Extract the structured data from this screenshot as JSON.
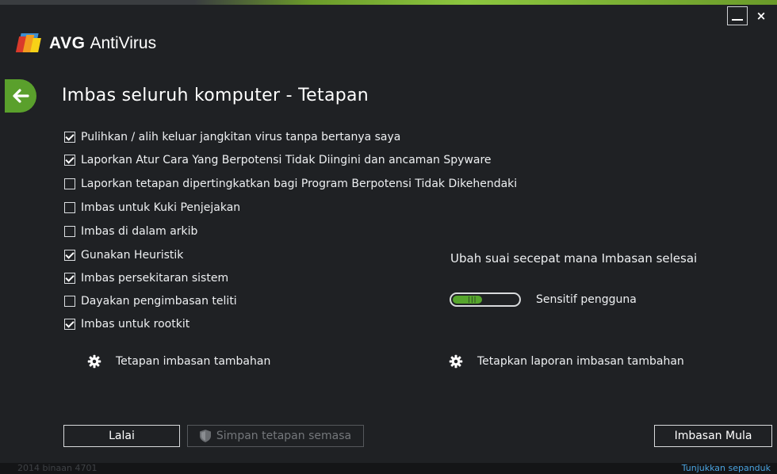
{
  "app": {
    "brand": "AVG",
    "product": "AntiVirus",
    "close_symbol": "×"
  },
  "page": {
    "title": "Imbas seluruh komputer - Tetapan"
  },
  "options": [
    {
      "label": "Pulihkan / alih keluar jangkitan virus tanpa bertanya saya",
      "checked": true
    },
    {
      "label": "Laporkan Atur Cara Yang Berpotensi Tidak Diingini dan ancaman Spyware",
      "checked": true
    },
    {
      "label": "Laporkan tetapan dipertingkatkan bagi Program Berpotensi Tidak Dikehendaki",
      "checked": false
    },
    {
      "label": "Imbas untuk Kuki Penjejakan",
      "checked": false
    },
    {
      "label": "Imbas di dalam arkib",
      "checked": false
    },
    {
      "label": "Gunakan Heuristik",
      "checked": true
    },
    {
      "label": "Imbas persekitaran sistem",
      "checked": true
    },
    {
      "label": "Dayakan pengimbasan teliti",
      "checked": false
    },
    {
      "label": "Imbas untuk rootkit",
      "checked": true
    }
  ],
  "speed": {
    "heading": "Ubah suai secepat mana Imbasan selesai",
    "level_label": "Sensitif pengguna",
    "level_fraction": 0.45
  },
  "links": {
    "additional_settings": "Tetapan imbasan tambahan",
    "additional_reports": "Tetapkan laporan imbasan tambahan"
  },
  "buttons": {
    "default": "Lalai",
    "save": "Simpan tetapan semasa",
    "start": "Imbasan Mula"
  },
  "status": {
    "build": "2014  binaan 4701",
    "help": "Tunjukkan sepanduk"
  },
  "colors": {
    "accent_green": "#56a52d",
    "link_blue": "#4aa3df",
    "background": "#1f2124"
  }
}
